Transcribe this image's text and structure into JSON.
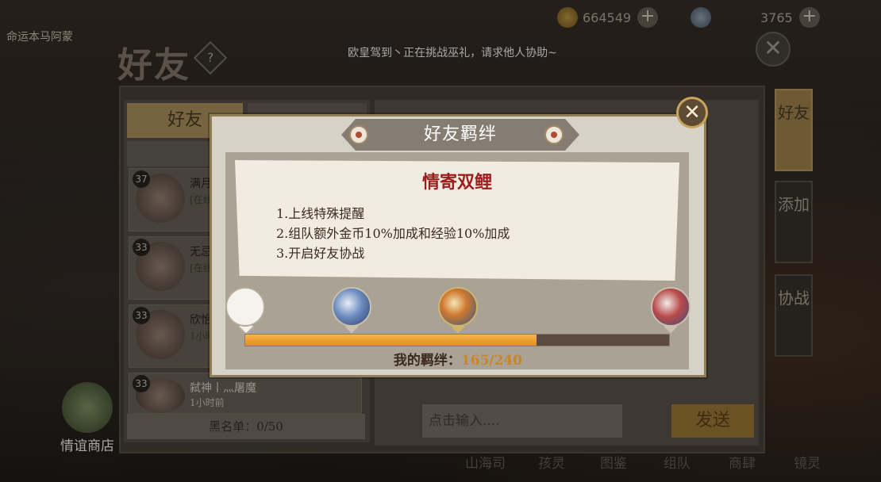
{
  "header": {
    "player_name": "命运本马阿蒙",
    "gold": "664549",
    "gems": "3765",
    "page_title": "好友",
    "help_label": "?",
    "marquee": "欧皇驾到丶正在挑战巫礼，请求他人协助~",
    "close_label": "✕"
  },
  "left_panel": {
    "tab_friends": "好友",
    "friends": [
      {
        "level": "37",
        "name": "满月",
        "status": "[在线]"
      },
      {
        "level": "33",
        "name": "无忌",
        "status": "[在线]"
      },
      {
        "level": "33",
        "name": "欣怡",
        "status": "1小时"
      },
      {
        "level": "33",
        "name": "弑神丨灬屠魔",
        "status": "1小时前"
      }
    ],
    "blacklist": "黑名单：0/50"
  },
  "chat": {
    "input_placeholder": "点击输入....",
    "send_label": "发送"
  },
  "side_tabs": [
    {
      "label": "好友"
    },
    {
      "label": "添加"
    },
    {
      "label": "协战"
    }
  ],
  "shop": {
    "label": "情谊商店"
  },
  "bottom_nav": [
    {
      "label": "山海司"
    },
    {
      "label": "孩灵"
    },
    {
      "label": "图鉴"
    },
    {
      "label": "组队"
    },
    {
      "label": "商肆"
    },
    {
      "label": "镜灵"
    }
  ],
  "modal": {
    "title": "好友羁绊",
    "close_label": "✕",
    "card_title": "情寄双鲤",
    "perks": [
      "1.上线特殊提醒",
      "2.组队额外金币10%加成和经验10%加成",
      "3.开启好友协战"
    ],
    "bond_label": "我的羁绊：",
    "bond_value": "165/240",
    "bond_current": 165,
    "bond_max": 240
  },
  "colors": {
    "progress_fill": "#e48f1c",
    "card_title": "#9a1e1e",
    "bond_value": "#c8862a"
  }
}
